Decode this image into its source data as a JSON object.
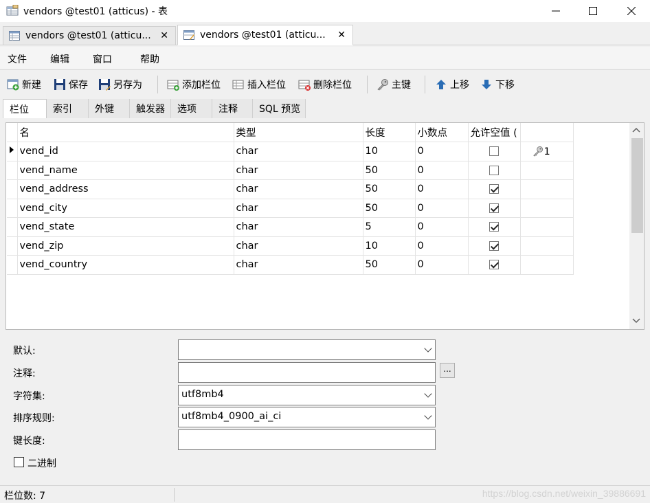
{
  "window": {
    "title": "vendors @test01 (atticus) - 表",
    "minimize_glyph": "—",
    "maximize_glyph": "☐",
    "close_glyph": "✕"
  },
  "doc_tabs": [
    {
      "label": "vendors @test01 (atticu...",
      "close": "✕"
    },
    {
      "label": "vendors @test01 (atticu...",
      "close": "✕"
    }
  ],
  "menu": {
    "file": "文件",
    "edit": "编辑",
    "window": "窗口",
    "help": "帮助"
  },
  "toolbar": {
    "new": "新建",
    "save": "保存",
    "save_as": "另存为",
    "add_field": "添加栏位",
    "insert_field": "插入栏位",
    "delete_field": "删除栏位",
    "primary_key": "主键",
    "move_up": "上移",
    "move_down": "下移"
  },
  "sub_tabs": [
    "栏位",
    "索引",
    "外键",
    "触发器",
    "选项",
    "注释",
    "SQL 预览"
  ],
  "grid": {
    "headers": {
      "name": "名",
      "type": "类型",
      "length": "长度",
      "decimals": "小数点",
      "nullable": "允许空值 (",
      "key": ""
    },
    "rows": [
      {
        "name": "vend_id",
        "type": "char",
        "length": "10",
        "decimals": "0",
        "nullable": false,
        "key": "1",
        "current": true
      },
      {
        "name": "vend_name",
        "type": "char",
        "length": "50",
        "decimals": "0",
        "nullable": false,
        "key": "",
        "current": false
      },
      {
        "name": "vend_address",
        "type": "char",
        "length": "50",
        "decimals": "0",
        "nullable": true,
        "key": "",
        "current": false
      },
      {
        "name": "vend_city",
        "type": "char",
        "length": "50",
        "decimals": "0",
        "nullable": true,
        "key": "",
        "current": false
      },
      {
        "name": "vend_state",
        "type": "char",
        "length": "5",
        "decimals": "0",
        "nullable": true,
        "key": "",
        "current": false
      },
      {
        "name": "vend_zip",
        "type": "char",
        "length": "10",
        "decimals": "0",
        "nullable": true,
        "key": "",
        "current": false
      },
      {
        "name": "vend_country",
        "type": "char",
        "length": "50",
        "decimals": "0",
        "nullable": true,
        "key": "",
        "current": false
      }
    ]
  },
  "properties": {
    "default_label": "默认:",
    "default_value": "",
    "comment_label": "注释:",
    "comment_value": "",
    "comment_button": "...",
    "charset_label": "字符集:",
    "charset_value": "utf8mb4",
    "collation_label": "排序规则:",
    "collation_value": "utf8mb4_0900_ai_ci",
    "key_length_label": "键长度:",
    "key_length_value": "",
    "binary_label": "二进制",
    "binary_checked": false
  },
  "status": {
    "field_count": "栏位数: 7",
    "watermark": "https://blog.csdn.net/weixin_39886691"
  },
  "colors": {
    "key_icon": "#8a8a8a",
    "toolbar_blue": "#2a6db5",
    "save_icon": "#1f3f78"
  }
}
